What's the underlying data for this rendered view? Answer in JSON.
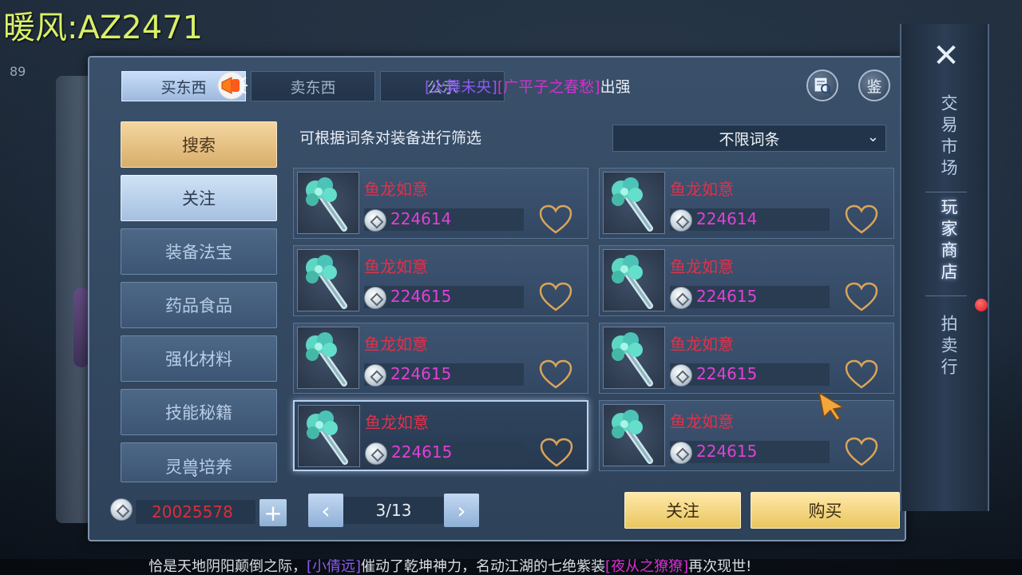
{
  "watermark": "暖风:AZ2471",
  "hud_number": "89",
  "tabs": [
    {
      "label": "买东西",
      "active": true
    },
    {
      "label": "卖东西",
      "active": false
    },
    {
      "label": "公示",
      "active": false
    }
  ],
  "broadcast": {
    "player": "[火舞未央]",
    "item": "[广平子之春愁]",
    "tail": "出强"
  },
  "top_buttons": {
    "search_icon_label": "",
    "appraise_label": "鉴"
  },
  "sidenav": [
    {
      "label": "搜索",
      "style": "search"
    },
    {
      "label": "关注",
      "style": "follow"
    },
    {
      "label": "装备法宝",
      "style": "normal"
    },
    {
      "label": "药品食品",
      "style": "normal"
    },
    {
      "label": "强化材料",
      "style": "normal"
    },
    {
      "label": "技能秘籍",
      "style": "normal"
    },
    {
      "label": "灵兽培养",
      "style": "cut"
    }
  ],
  "filter": {
    "hint": "可根据词条对装备进行筛选",
    "selected": "不限词条"
  },
  "items": [
    {
      "name": "鱼龙如意",
      "price": "224614"
    },
    {
      "name": "鱼龙如意",
      "price": "224614"
    },
    {
      "name": "鱼龙如意",
      "price": "224615"
    },
    {
      "name": "鱼龙如意",
      "price": "224615"
    },
    {
      "name": "鱼龙如意",
      "price": "224615"
    },
    {
      "name": "鱼龙如意",
      "price": "224615"
    },
    {
      "name": "鱼龙如意",
      "price": "224615"
    },
    {
      "name": "鱼龙如意",
      "price": "224615"
    }
  ],
  "footer": {
    "money": "20025578",
    "plus": "+",
    "page": "3/13",
    "prev": "‹",
    "next": "›",
    "follow_label": "关注",
    "buy_label": "购买"
  },
  "right_nav": {
    "close": "✕",
    "items": [
      {
        "label": "交易市场",
        "active": false
      },
      {
        "label": "玩家商店",
        "active": true
      },
      {
        "label": "拍卖行",
        "active": false
      }
    ]
  },
  "ticker": {
    "pre": "恰是天地阴阳颠倒之际，",
    "player": "[小倩远]",
    "mid": "催动了乾坤神力，名动江湖的七绝紫装",
    "item": "[夜从之獠獠]",
    "post": "再次现世!"
  },
  "colors": {
    "item_name": "#e3304a",
    "price": "#e040d8",
    "money": "#d7303a",
    "gold_button": "#e9c660"
  }
}
